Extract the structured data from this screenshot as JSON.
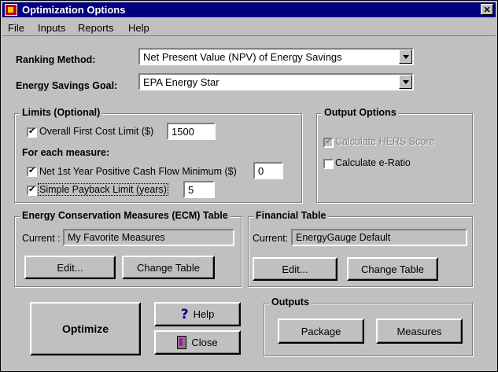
{
  "window": {
    "title": "Optimization Options"
  },
  "menu": [
    "File",
    "Inputs",
    "Reports",
    "Help"
  ],
  "ranking": {
    "label": "Ranking Method:",
    "value": "Net Present Value (NPV) of Energy Savings"
  },
  "goal": {
    "label": "Energy Savings Goal:",
    "value": "EPA Energy Star"
  },
  "limits": {
    "title": "Limits (Optional)",
    "first_cost_label": "Overall First Cost Limit ($)",
    "first_cost_value": "1500",
    "each_measure_label": "For each measure:",
    "cashflow_label": "Net 1st Year Positive Cash Flow Minimum ($)",
    "cashflow_value": "0",
    "payback_label": "Simple Payback Limit (years)",
    "payback_value": "5"
  },
  "output_options": {
    "title": "Output Options",
    "hers_label": "Calculate HERS Score",
    "eratio_label": "Calculate e-Ratio"
  },
  "ecm": {
    "title": "Energy Conservation Measures (ECM) Table",
    "current_label": "Current :",
    "current_value": "My Favorite Measures",
    "edit": "Edit...",
    "change": "Change Table"
  },
  "financial": {
    "title": "Financial Table",
    "current_label": "Current:",
    "current_value": "EnergyGauge Default",
    "edit": "Edit...",
    "change": "Change Table"
  },
  "buttons": {
    "optimize": "Optimize",
    "help": "Help",
    "close": "Close"
  },
  "outputs": {
    "title": "Outputs",
    "package": "Package",
    "measures": "Measures"
  }
}
